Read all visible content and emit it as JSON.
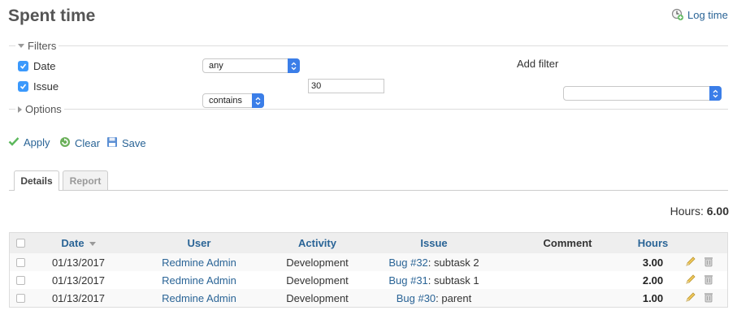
{
  "page": {
    "title": "Spent time"
  },
  "header": {
    "log_time_label": "Log time",
    "log_time_icon": "clock-add-icon"
  },
  "filters": {
    "legend": "Filters",
    "rows": [
      {
        "label": "Date",
        "checked": true,
        "operator": "any",
        "value": ""
      },
      {
        "label": "Issue",
        "checked": true,
        "operator": "contains",
        "value": "30"
      }
    ],
    "add_filter_label": "Add filter",
    "add_filter_value": ""
  },
  "options": {
    "legend": "Options"
  },
  "actions": {
    "apply": "Apply",
    "clear": "Clear",
    "save": "Save"
  },
  "tabs": [
    {
      "label": "Details",
      "active": true
    },
    {
      "label": "Report",
      "active": false
    }
  ],
  "total": {
    "label": "Hours:",
    "value": "6.00"
  },
  "table": {
    "columns": [
      "Date",
      "User",
      "Activity",
      "Issue",
      "Comment",
      "Hours"
    ],
    "rows": [
      {
        "date": "01/13/2017",
        "user": "Redmine Admin",
        "activity": "Development",
        "issue_link": "Bug #32",
        "issue_subject": ": subtask 2",
        "comment": "",
        "hours": "3.00"
      },
      {
        "date": "01/13/2017",
        "user": "Redmine Admin",
        "activity": "Development",
        "issue_link": "Bug #31",
        "issue_subject": ": subtask 1",
        "comment": "",
        "hours": "2.00"
      },
      {
        "date": "01/13/2017",
        "user": "Redmine Admin",
        "activity": "Development",
        "issue_link": "Bug #30",
        "issue_subject": ": parent",
        "comment": "",
        "hours": "1.00"
      }
    ]
  },
  "colors": {
    "link": "#2a6496",
    "select_arrow": "#3b7ee8",
    "checkbox": "#3b99fc",
    "apply_check": "#5cb85c"
  }
}
